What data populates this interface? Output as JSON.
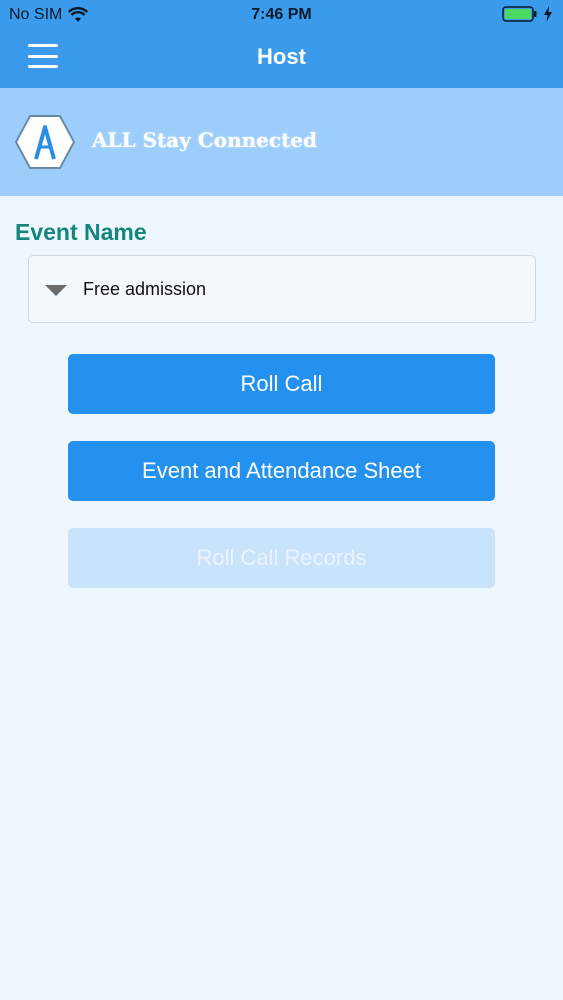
{
  "status_bar": {
    "carrier": "No SIM",
    "time": "7:46 PM"
  },
  "nav": {
    "title": "Host"
  },
  "brand": {
    "name": "ALL Stay Connected"
  },
  "form": {
    "event_label": "Event Name",
    "event_selected": "Free admission"
  },
  "buttons": {
    "roll_call": "Roll Call",
    "event_attendance": "Event and Attendance Sheet",
    "roll_call_records": "Roll Call Records"
  },
  "colors": {
    "nav_bg": "#3a9bed",
    "brand_bg": "#9dcefb",
    "label": "#14857c",
    "button_primary": "#2491ef",
    "button_disabled": "#c9e3fb",
    "battery": "#4cd964"
  },
  "icons": [
    "wifi-icon",
    "battery-icon",
    "bolt-icon",
    "menu-icon",
    "logo",
    "caret-down-icon"
  ]
}
